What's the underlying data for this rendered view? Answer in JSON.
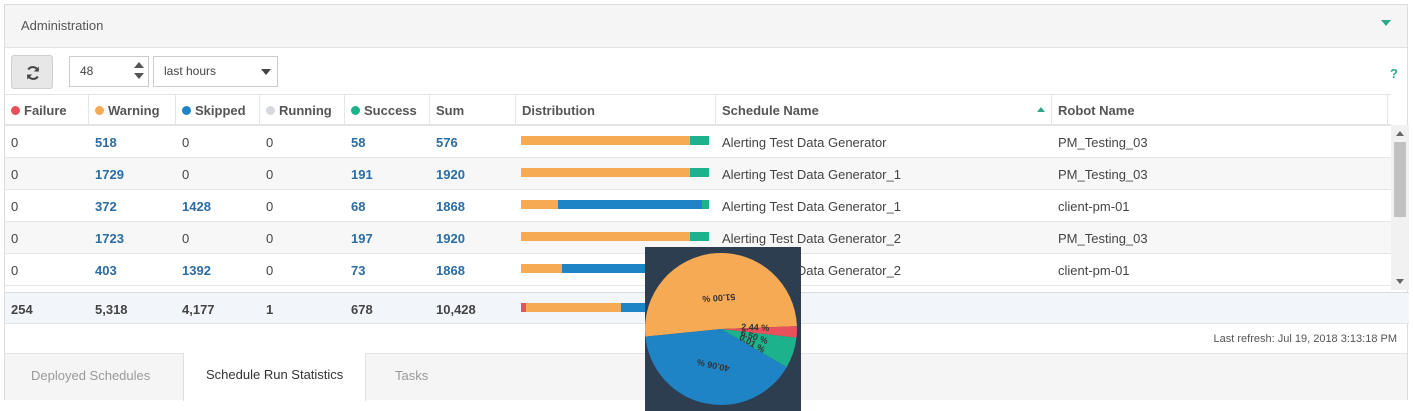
{
  "panel": {
    "title": "Administration"
  },
  "toolbar": {
    "refresh_icon": "refresh-icon",
    "hours_value": "48",
    "range_select": "last hours",
    "help_label": "?"
  },
  "columns": {
    "failure": "Failure",
    "warning": "Warning",
    "skipped": "Skipped",
    "running": "Running",
    "success": "Success",
    "sum": "Sum",
    "distribution": "Distribution",
    "schedule_name": "Schedule Name",
    "robot_name": "Robot Name"
  },
  "colors": {
    "failure": "#e8505b",
    "warning": "#f6aa54",
    "skipped": "#1f84c6",
    "running": "#d5d9dd",
    "success": "#1bb28c",
    "accent": "#2fa88a"
  },
  "rows": [
    {
      "failure": "0",
      "warning": "518",
      "skipped": "0",
      "running": "0",
      "success": "58",
      "sum": "576",
      "schedule": "Alerting Test Data Generator",
      "robot": "PM_Testing_03"
    },
    {
      "failure": "0",
      "warning": "1729",
      "skipped": "0",
      "running": "0",
      "success": "191",
      "sum": "1920",
      "schedule": "Alerting Test Data Generator_1",
      "robot": "PM_Testing_03"
    },
    {
      "failure": "0",
      "warning": "372",
      "skipped": "1428",
      "running": "0",
      "success": "68",
      "sum": "1868",
      "schedule": "Alerting Test Data Generator_1",
      "robot": "client-pm-01"
    },
    {
      "failure": "0",
      "warning": "1723",
      "skipped": "0",
      "running": "0",
      "success": "197",
      "sum": "1920",
      "schedule": "Alerting Test Data Generator_2",
      "robot": "PM_Testing_03"
    },
    {
      "failure": "0",
      "warning": "403",
      "skipped": "1392",
      "running": "0",
      "success": "73",
      "sum": "1868",
      "schedule": "Alerting Test Data Generator_2",
      "robot": "client-pm-01"
    }
  ],
  "totals": {
    "failure": "254",
    "warning": "5,318",
    "skipped": "4,177",
    "running": "1",
    "success": "678",
    "sum": "10,428"
  },
  "totals_distribution": {
    "failure": 254,
    "warning": 5318,
    "skipped": 4177,
    "running": 1,
    "success": 678
  },
  "last_refresh": "Last refresh: Jul 19, 2018 3:13:18 PM",
  "tabs": [
    "Deployed Schedules",
    "Schedule Run Statistics",
    "Tasks"
  ],
  "chart_data": {
    "type": "pie",
    "categories": [
      "Failure",
      "Warning",
      "Skipped",
      "Running",
      "Success"
    ],
    "values": [
      2.44,
      51.0,
      40.06,
      0.01,
      6.5
    ],
    "data_labels": [
      "2.44 %",
      "51.00 %",
      "40.06 %",
      "0.01 %",
      "6.50 %"
    ],
    "colors": [
      "#e8505b",
      "#f6aa54",
      "#1f84c6",
      "#d5d9dd",
      "#1bb28c"
    ]
  }
}
